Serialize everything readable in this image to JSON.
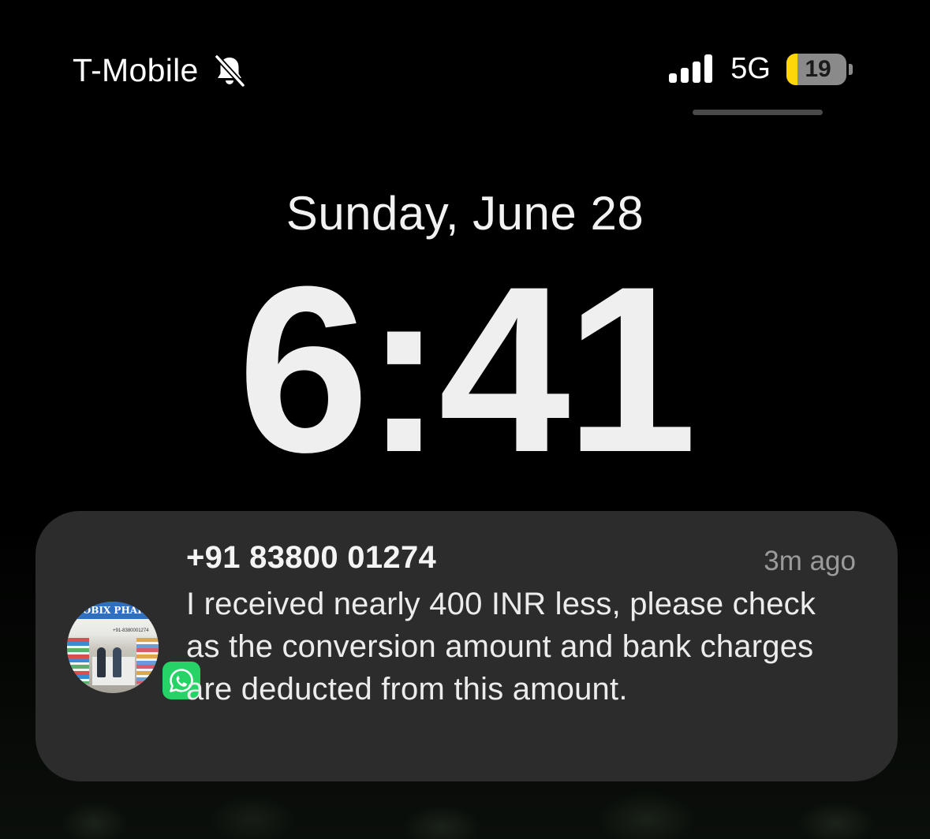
{
  "status_bar": {
    "carrier": "T-Mobile",
    "silent_icon": "bell-slash-icon",
    "signal_icon": "cellular-signal-icon",
    "network": "5G",
    "battery_level": 19,
    "battery_text": "19",
    "battery_color": "#ffd60a"
  },
  "lock_screen": {
    "date": "Sunday, June 28",
    "time": "6:41"
  },
  "notification": {
    "sender": "+91 83800 01274",
    "time_ago": "3m ago",
    "message": "I received nearly 400 INR less, please check as the conversion amount and bank charges are deducted from this amount.",
    "avatar_text": "LOBIX PHARI",
    "avatar_subtext": "+91-8380001274",
    "app_badge_icon": "whatsapp-icon",
    "app_badge_color": "#25d366"
  }
}
